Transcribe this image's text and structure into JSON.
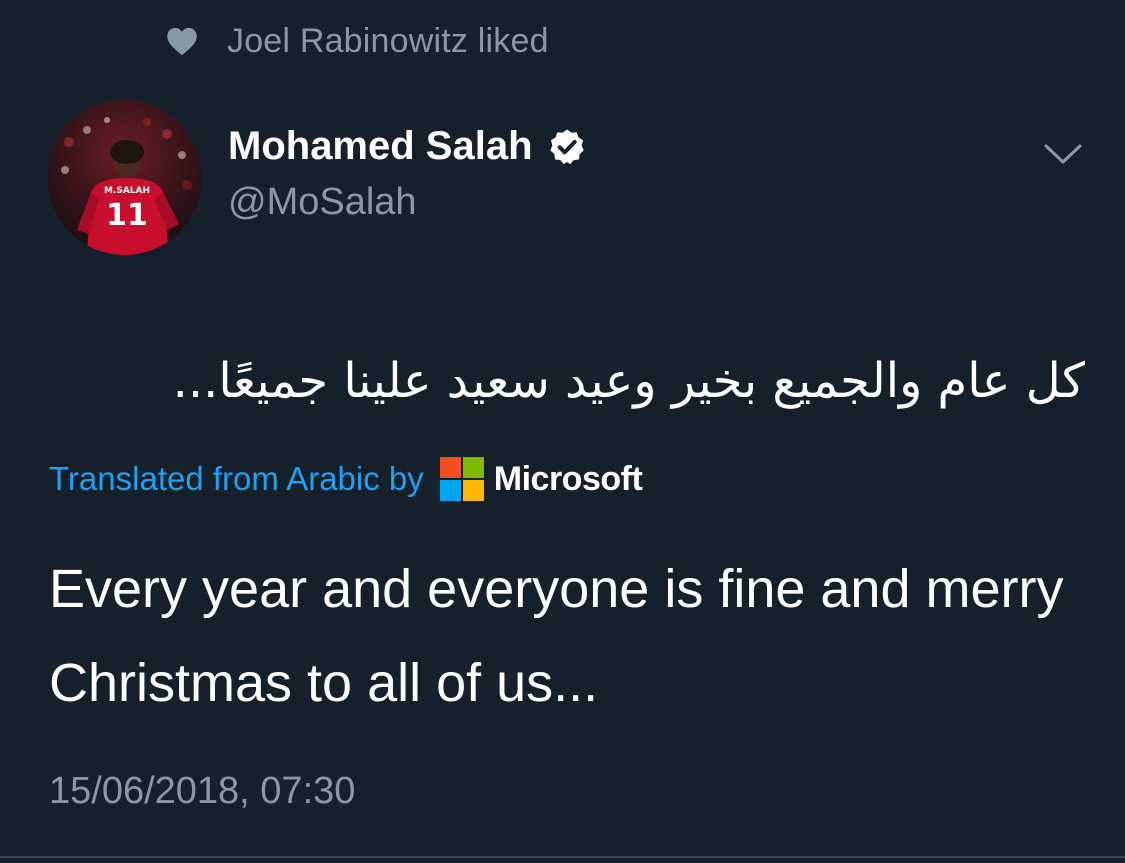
{
  "social_context": {
    "icon": "heart-icon",
    "text": "Joel Rabinowitz liked"
  },
  "author": {
    "display_name": "Mohamed Salah",
    "handle": "@MoSalah",
    "verified": true,
    "avatar_jersey_name": "M.SALAH",
    "avatar_jersey_number": "11"
  },
  "tweet": {
    "original_text": "كل عام والجميع بخير وعيد سعيد علينا جميعًا...",
    "translation_label": "Translated from Arabic by",
    "translation_provider": "Microsoft",
    "translated_text": "Every year and everyone is fine and merry Christmas to all of us...",
    "timestamp": "15/06/2018, 07:30"
  },
  "colors": {
    "background": "#15202b",
    "secondary_text": "#8899a6",
    "link_blue": "#1da1f2",
    "ms_red": "#f25022",
    "ms_green": "#7fba00",
    "ms_blue": "#00a4ef",
    "ms_yellow": "#ffb900"
  }
}
